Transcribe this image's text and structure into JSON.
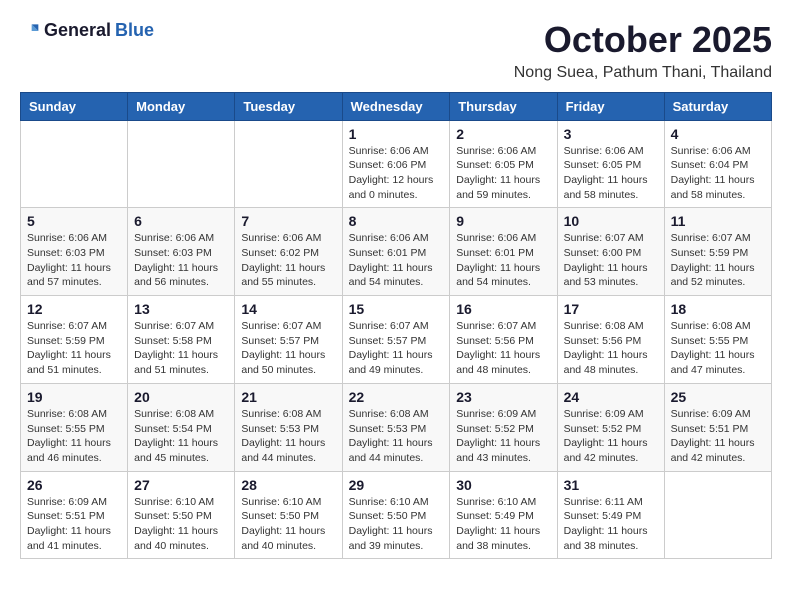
{
  "header": {
    "logo_general": "General",
    "logo_blue": "Blue",
    "month": "October 2025",
    "location": "Nong Suea, Pathum Thani, Thailand"
  },
  "weekdays": [
    "Sunday",
    "Monday",
    "Tuesday",
    "Wednesday",
    "Thursday",
    "Friday",
    "Saturday"
  ],
  "weeks": [
    [
      {
        "day": "",
        "info": ""
      },
      {
        "day": "",
        "info": ""
      },
      {
        "day": "",
        "info": ""
      },
      {
        "day": "1",
        "info": "Sunrise: 6:06 AM\nSunset: 6:06 PM\nDaylight: 12 hours\nand 0 minutes."
      },
      {
        "day": "2",
        "info": "Sunrise: 6:06 AM\nSunset: 6:05 PM\nDaylight: 11 hours\nand 59 minutes."
      },
      {
        "day": "3",
        "info": "Sunrise: 6:06 AM\nSunset: 6:05 PM\nDaylight: 11 hours\nand 58 minutes."
      },
      {
        "day": "4",
        "info": "Sunrise: 6:06 AM\nSunset: 6:04 PM\nDaylight: 11 hours\nand 58 minutes."
      }
    ],
    [
      {
        "day": "5",
        "info": "Sunrise: 6:06 AM\nSunset: 6:03 PM\nDaylight: 11 hours\nand 57 minutes."
      },
      {
        "day": "6",
        "info": "Sunrise: 6:06 AM\nSunset: 6:03 PM\nDaylight: 11 hours\nand 56 minutes."
      },
      {
        "day": "7",
        "info": "Sunrise: 6:06 AM\nSunset: 6:02 PM\nDaylight: 11 hours\nand 55 minutes."
      },
      {
        "day": "8",
        "info": "Sunrise: 6:06 AM\nSunset: 6:01 PM\nDaylight: 11 hours\nand 54 minutes."
      },
      {
        "day": "9",
        "info": "Sunrise: 6:06 AM\nSunset: 6:01 PM\nDaylight: 11 hours\nand 54 minutes."
      },
      {
        "day": "10",
        "info": "Sunrise: 6:07 AM\nSunset: 6:00 PM\nDaylight: 11 hours\nand 53 minutes."
      },
      {
        "day": "11",
        "info": "Sunrise: 6:07 AM\nSunset: 5:59 PM\nDaylight: 11 hours\nand 52 minutes."
      }
    ],
    [
      {
        "day": "12",
        "info": "Sunrise: 6:07 AM\nSunset: 5:59 PM\nDaylight: 11 hours\nand 51 minutes."
      },
      {
        "day": "13",
        "info": "Sunrise: 6:07 AM\nSunset: 5:58 PM\nDaylight: 11 hours\nand 51 minutes."
      },
      {
        "day": "14",
        "info": "Sunrise: 6:07 AM\nSunset: 5:57 PM\nDaylight: 11 hours\nand 50 minutes."
      },
      {
        "day": "15",
        "info": "Sunrise: 6:07 AM\nSunset: 5:57 PM\nDaylight: 11 hours\nand 49 minutes."
      },
      {
        "day": "16",
        "info": "Sunrise: 6:07 AM\nSunset: 5:56 PM\nDaylight: 11 hours\nand 48 minutes."
      },
      {
        "day": "17",
        "info": "Sunrise: 6:08 AM\nSunset: 5:56 PM\nDaylight: 11 hours\nand 48 minutes."
      },
      {
        "day": "18",
        "info": "Sunrise: 6:08 AM\nSunset: 5:55 PM\nDaylight: 11 hours\nand 47 minutes."
      }
    ],
    [
      {
        "day": "19",
        "info": "Sunrise: 6:08 AM\nSunset: 5:55 PM\nDaylight: 11 hours\nand 46 minutes."
      },
      {
        "day": "20",
        "info": "Sunrise: 6:08 AM\nSunset: 5:54 PM\nDaylight: 11 hours\nand 45 minutes."
      },
      {
        "day": "21",
        "info": "Sunrise: 6:08 AM\nSunset: 5:53 PM\nDaylight: 11 hours\nand 44 minutes."
      },
      {
        "day": "22",
        "info": "Sunrise: 6:08 AM\nSunset: 5:53 PM\nDaylight: 11 hours\nand 44 minutes."
      },
      {
        "day": "23",
        "info": "Sunrise: 6:09 AM\nSunset: 5:52 PM\nDaylight: 11 hours\nand 43 minutes."
      },
      {
        "day": "24",
        "info": "Sunrise: 6:09 AM\nSunset: 5:52 PM\nDaylight: 11 hours\nand 42 minutes."
      },
      {
        "day": "25",
        "info": "Sunrise: 6:09 AM\nSunset: 5:51 PM\nDaylight: 11 hours\nand 42 minutes."
      }
    ],
    [
      {
        "day": "26",
        "info": "Sunrise: 6:09 AM\nSunset: 5:51 PM\nDaylight: 11 hours\nand 41 minutes."
      },
      {
        "day": "27",
        "info": "Sunrise: 6:10 AM\nSunset: 5:50 PM\nDaylight: 11 hours\nand 40 minutes."
      },
      {
        "day": "28",
        "info": "Sunrise: 6:10 AM\nSunset: 5:50 PM\nDaylight: 11 hours\nand 40 minutes."
      },
      {
        "day": "29",
        "info": "Sunrise: 6:10 AM\nSunset: 5:50 PM\nDaylight: 11 hours\nand 39 minutes."
      },
      {
        "day": "30",
        "info": "Sunrise: 6:10 AM\nSunset: 5:49 PM\nDaylight: 11 hours\nand 38 minutes."
      },
      {
        "day": "31",
        "info": "Sunrise: 6:11 AM\nSunset: 5:49 PM\nDaylight: 11 hours\nand 38 minutes."
      },
      {
        "day": "",
        "info": ""
      }
    ]
  ]
}
